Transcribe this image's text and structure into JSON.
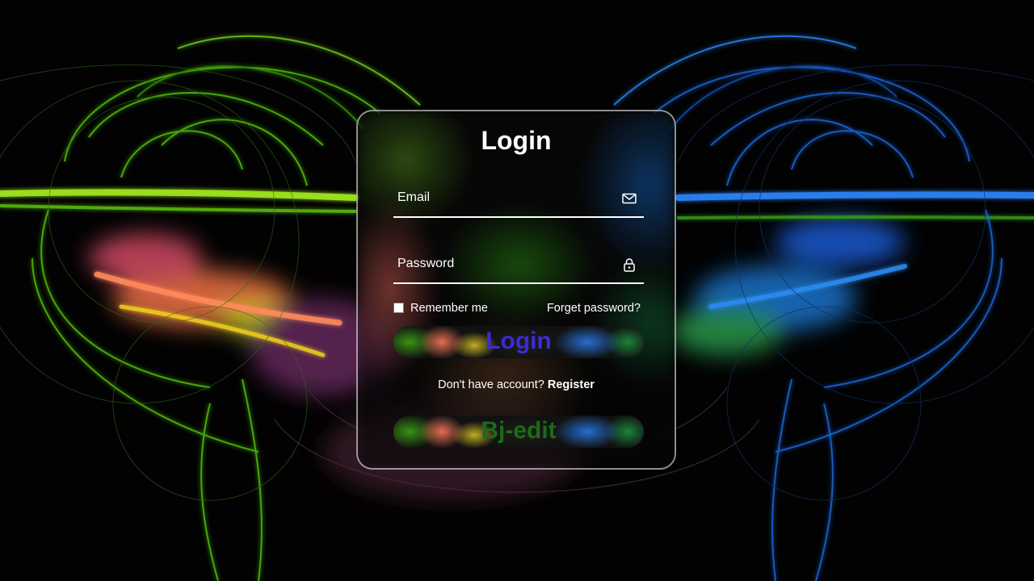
{
  "form": {
    "title": "Login",
    "email_placeholder": "Email",
    "password_placeholder": "Password",
    "remember_label": "Remember me",
    "remember_checked": false,
    "forgot_link": "Forget password?",
    "login_button": "Login",
    "register_prompt": "Don't have account?",
    "register_link": "Register",
    "edit_button": "Bj-edit"
  },
  "icons": {
    "email": "mail-icon",
    "password": "lock-icon"
  },
  "colors": {
    "login_button_text": "#3a2cd8",
    "edit_button_text": "#1c6a1c",
    "card_border": "#bdbdbd"
  }
}
